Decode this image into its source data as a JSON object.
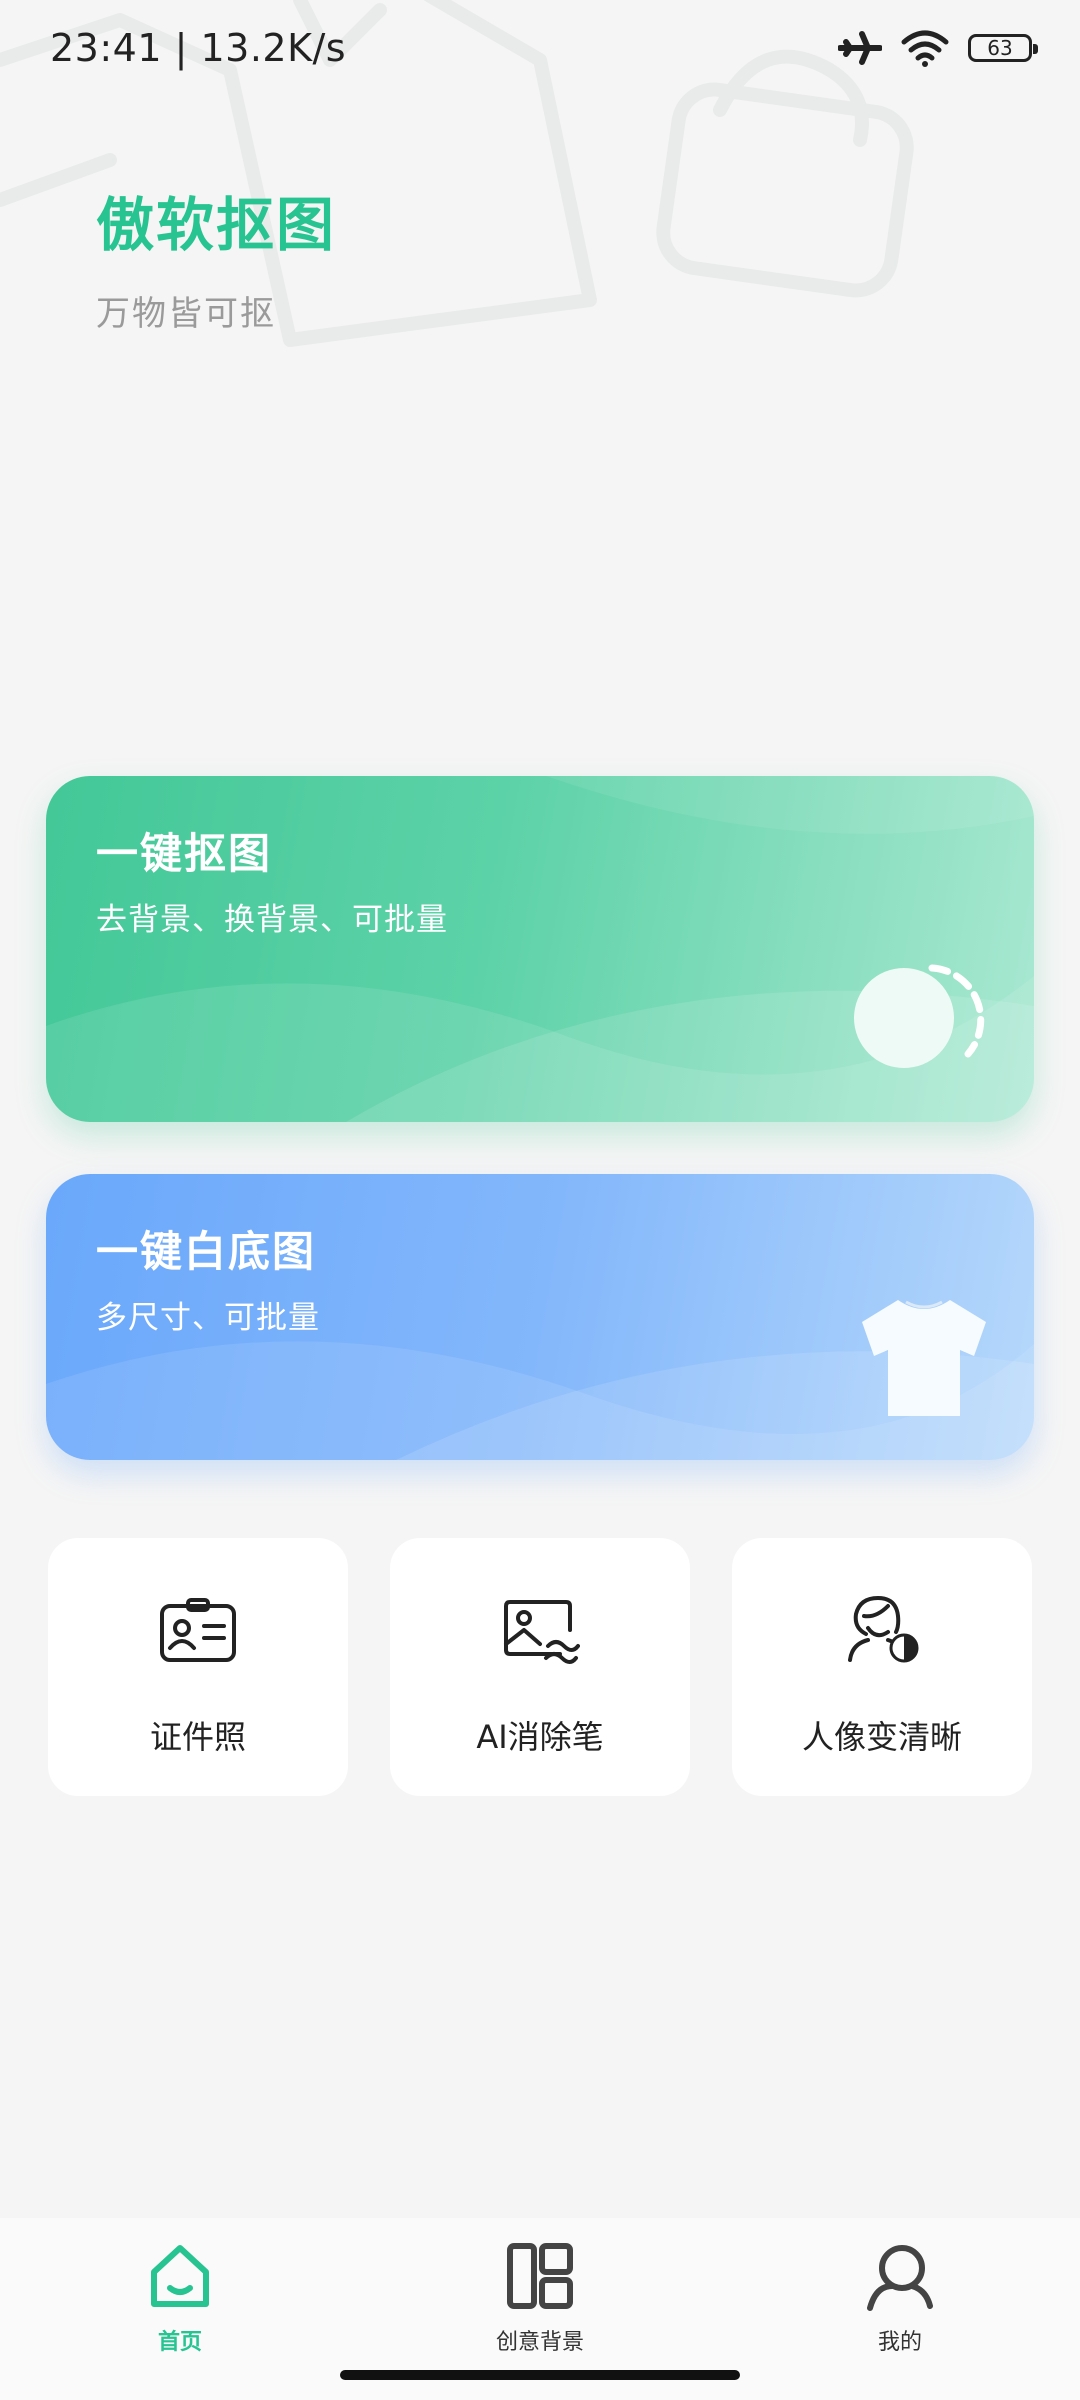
{
  "status_bar": {
    "time": "23:41 | 13.2K/s",
    "battery": "63",
    "icons": [
      "airplane-icon",
      "wifi-icon",
      "battery-icon"
    ]
  },
  "header": {
    "title": "傲软抠图",
    "subtitle": "万物皆可抠"
  },
  "cards": [
    {
      "title": "一键抠图",
      "desc": "去背景、换背景、可批量",
      "icon": "toggle-cutout-icon"
    },
    {
      "title": "一键白底图",
      "desc": "多尺寸、可批量",
      "icon": "tshirt-icon"
    }
  ],
  "tools": [
    {
      "label": "证件照",
      "icon": "id-card-icon"
    },
    {
      "label": "AI消除笔",
      "icon": "image-eraser-icon"
    },
    {
      "label": "人像变清晰",
      "icon": "portrait-enhance-icon"
    }
  ],
  "nav": {
    "items": [
      {
        "label": "首页",
        "icon": "home-icon",
        "active": true
      },
      {
        "label": "创意背景",
        "icon": "layout-icon",
        "active": false
      },
      {
        "label": "我的",
        "icon": "user-icon",
        "active": false
      }
    ]
  },
  "colors": {
    "accent": "#27c491",
    "card_green": "#43c898",
    "card_blue": "#6aa8fb",
    "background": "#f5f5f5"
  }
}
